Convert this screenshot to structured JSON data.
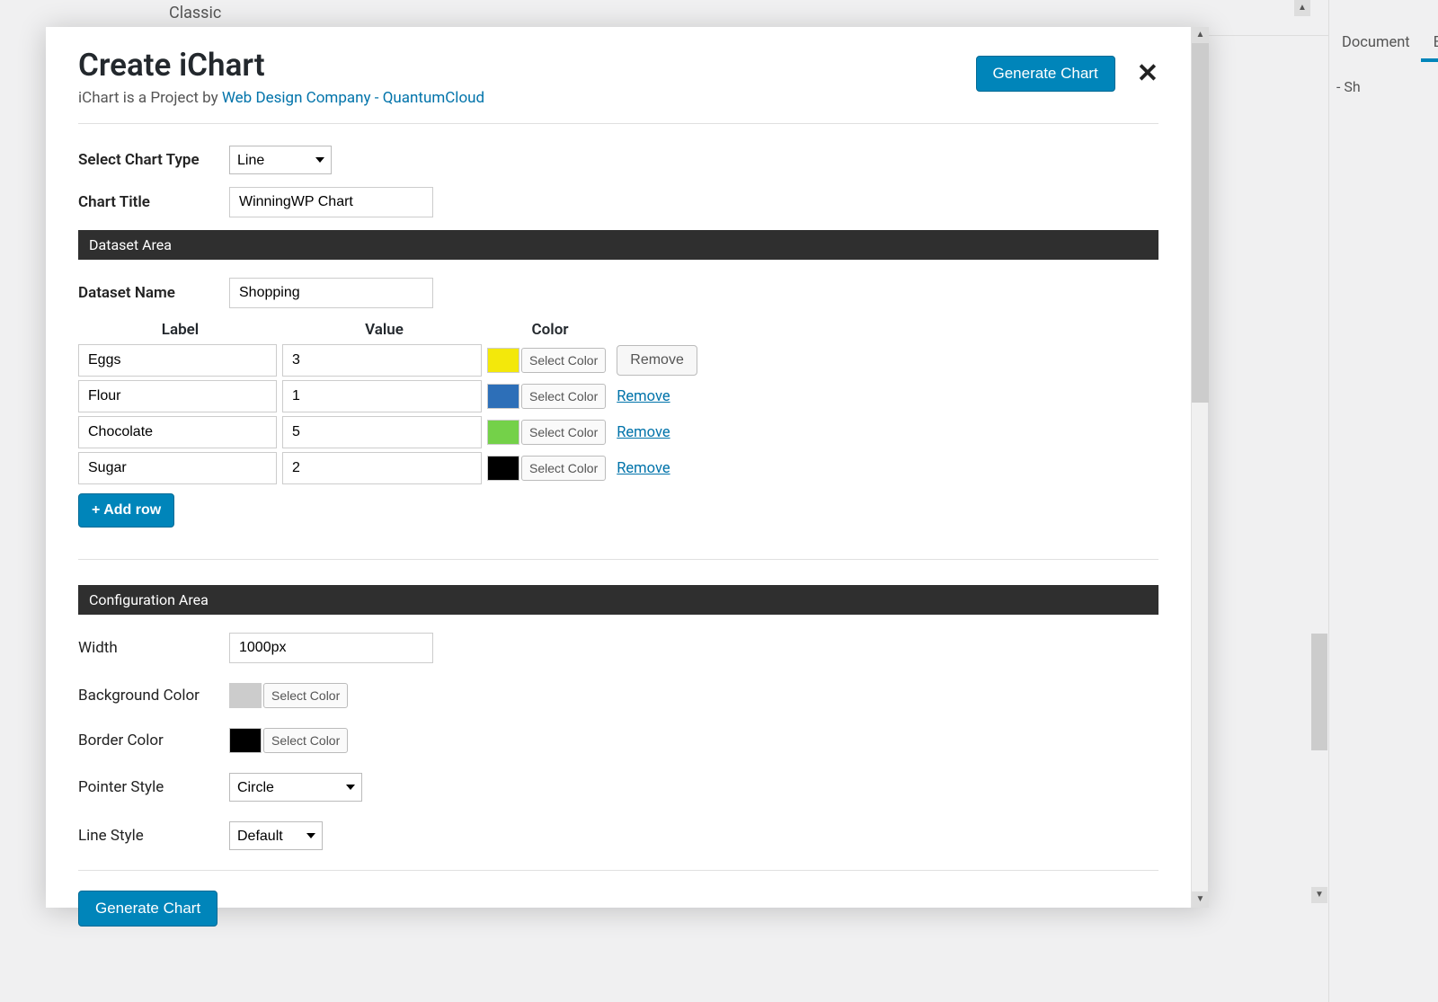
{
  "background": {
    "classic_text": "Classic",
    "sidebar_tabs": {
      "document": "Document",
      "block": "Blo"
    },
    "sidebar_shortcut": "- Sh"
  },
  "header": {
    "title": "Create iChart",
    "subtitle_prefix": "iChart is a Project by ",
    "subtitle_link": "Web Design Company - QuantumCloud",
    "generate_button": "Generate Chart"
  },
  "form": {
    "chart_type_label": "Select Chart Type",
    "chart_type_value": "Line",
    "chart_title_label": "Chart Title",
    "chart_title_value": "WinningWP Chart"
  },
  "dataset": {
    "section_title": "Dataset Area",
    "name_label": "Dataset Name",
    "name_value": "Shopping",
    "col_label": "Label",
    "col_value": "Value",
    "col_color": "Color",
    "rows": [
      {
        "label": "Eggs",
        "value": "3",
        "color": "#f3e80b",
        "remove_style": "button"
      },
      {
        "label": "Flour",
        "value": "1",
        "color": "#2d6fb8",
        "remove_style": "link"
      },
      {
        "label": "Chocolate",
        "value": "5",
        "color": "#74d149",
        "remove_style": "link"
      },
      {
        "label": "Sugar",
        "value": "2",
        "color": "#000000",
        "remove_style": "link"
      }
    ],
    "select_color_text": "Select Color",
    "remove_text": "Remove",
    "add_row_text": "+ Add row"
  },
  "config": {
    "section_title": "Configuration Area",
    "width_label": "Width",
    "width_value": "1000px",
    "bg_color_label": "Background Color",
    "bg_color_value": "#cccccc",
    "border_color_label": "Border Color",
    "border_color_value": "#000000",
    "select_color_text": "Select Color",
    "pointer_style_label": "Pointer Style",
    "pointer_style_value": "Circle",
    "line_style_label": "Line Style",
    "line_style_value": "Default"
  },
  "footer": {
    "generate_button": "Generate Chart"
  }
}
